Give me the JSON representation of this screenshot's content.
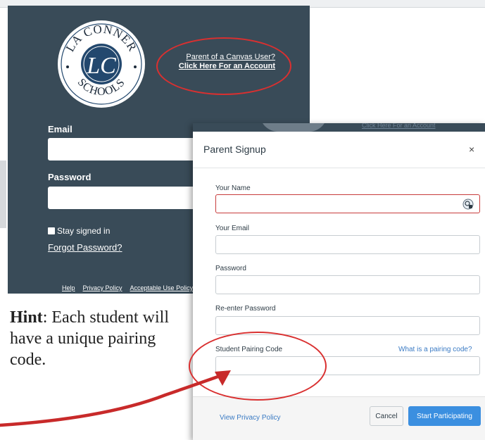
{
  "login": {
    "logo": {
      "top": "LA CONNER",
      "bottom": "SCHOOLS",
      "monogram": "LC"
    },
    "parent_link_line1": "Parent of a Canvas User?",
    "parent_link_line2": "Click Here For an Account",
    "email_label": "Email",
    "password_label": "Password",
    "stay_signed_in": "Stay signed in",
    "forgot_password": "Forgot Password?",
    "footer": {
      "help": "Help",
      "privacy": "Privacy Policy",
      "aup": "Acceptable Use Policy"
    }
  },
  "hint": {
    "bold": "Hint",
    "text": ": Each student will have a unique pairing code."
  },
  "modal": {
    "peek_link": "Click Here For an Account",
    "title": "Parent Signup",
    "close": "×",
    "name_label": "Your Name",
    "email_label": "Your Email",
    "password_label": "Password",
    "reenter_label": "Re-enter Password",
    "pairing_label": "Student Pairing Code",
    "pairing_help": "What is a pairing code?",
    "privacy_link": "View Privacy Policy",
    "cancel": "Cancel",
    "start": "Start Participating"
  },
  "colors": {
    "panel": "#394b58",
    "annotation_red": "#d93030",
    "accent_blue": "#3b8fe0"
  }
}
